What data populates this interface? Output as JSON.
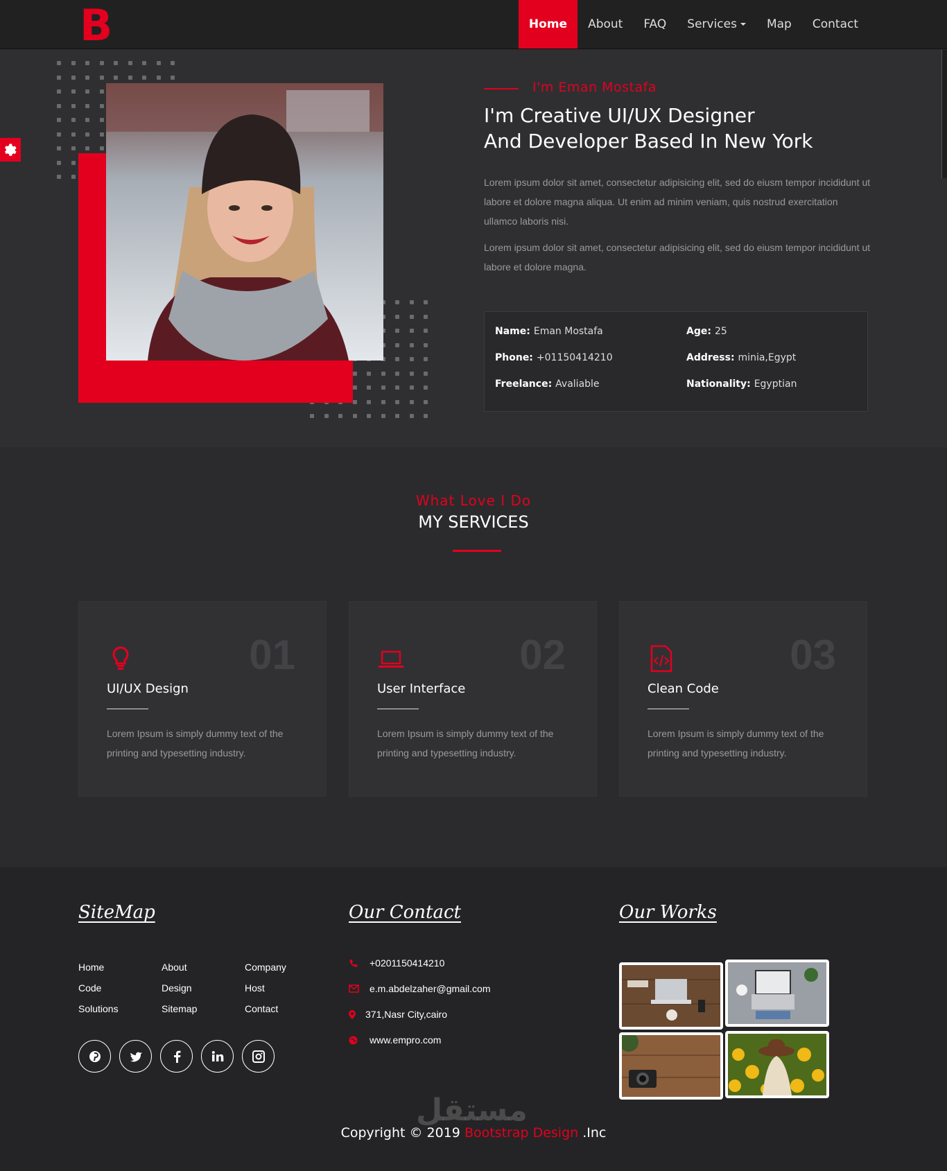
{
  "brand": {
    "logo": "B",
    "accent": "#e3001e"
  },
  "nav": {
    "items": [
      {
        "label": "Home",
        "active": true
      },
      {
        "label": "About"
      },
      {
        "label": "FAQ"
      },
      {
        "label": "Services",
        "dropdown": true
      },
      {
        "label": "Map"
      },
      {
        "label": "Contact"
      }
    ]
  },
  "hero": {
    "intro": "I'm Eman Mostafa",
    "title_line1": "I'm Creative UI/UX Designer",
    "title_line2": "And Developer Based In New York",
    "paragraph1": "Lorem ipsum dolor sit amet, consectetur adipisicing elit, sed do eiusm tempor incididunt ut labore et dolore magna aliqua. Ut enim ad minim veniam, quis nostrud exercitation ullamco laboris nisi.",
    "paragraph2": "Lorem ipsum dolor sit amet, consectetur adipisicing elit, sed do eiusm tempor incididunt ut labore et dolore magna.",
    "info": {
      "name_label": "Name:",
      "name": "Eman Mostafa",
      "age_label": "Age:",
      "age": "25",
      "phone_label": "Phone:",
      "phone": "+01150414210",
      "address_label": "Address:",
      "address": "minia,Egypt",
      "freelance_label": "Freelance:",
      "freelance": "Avaliable",
      "nationality_label": "Nationality:",
      "nationality": "Egyptian"
    }
  },
  "services": {
    "subtitle": "What Love I Do",
    "title": "MY SERVICES",
    "cards": [
      {
        "num": "01",
        "title": "UI/UX Design",
        "icon": "lightbulb-icon",
        "desc": "Lorem Ipsum is simply dummy text of the printing and typesetting industry."
      },
      {
        "num": "02",
        "title": "User Interface",
        "icon": "laptop-icon",
        "desc": "Lorem Ipsum is simply dummy text of the printing and typesetting industry."
      },
      {
        "num": "03",
        "title": "Clean Code",
        "icon": "code-file-icon",
        "desc": "Lorem Ipsum is simply dummy text of the printing and typesetting industry."
      }
    ]
  },
  "footer": {
    "sitemap_title": "SiteMap",
    "sitemap_links": [
      "Home",
      "About",
      "Company",
      "Code",
      "Design",
      "Host",
      "Solutions",
      "Sitemap",
      "Contact"
    ],
    "socials": [
      "pinterest-icon",
      "twitter-icon",
      "facebook-icon",
      "linkedin-icon",
      "instagram-icon"
    ],
    "contact_title": "Our Contact",
    "contact": {
      "phone": "+0201150414210",
      "email": "e.m.abdelzaher@gmail.com",
      "address": "371,Nasr City,cairo",
      "website": "www.empro.com"
    },
    "works_title": "Our Works",
    "copyright_prefix": "Copyright © 2019",
    "copyright_brand": "Bootstrap Design",
    "copyright_suffix": ".Inc",
    "watermark": "مستقل"
  }
}
